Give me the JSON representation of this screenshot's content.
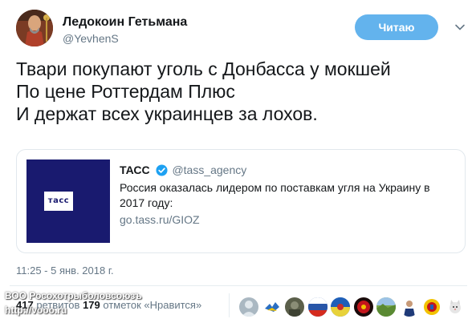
{
  "author": {
    "display_name": "Ледокоин Гетьмана",
    "handle": "@YevhenS",
    "avatar_icon": "avatar-portrait-icon"
  },
  "follow_button": {
    "label": "Читаю"
  },
  "tweet": {
    "lines": [
      "Твари покупают уголь с Донбасса у мокшей",
      "По цене Роттердам Плюс",
      "И держат всех украинцев за лохов."
    ]
  },
  "card": {
    "logo_text": "тасс",
    "name": "ТАСС",
    "handle": "@tass_agency",
    "description": "Россия оказалась лидером по поставкам угля на Украину в 2017 году:",
    "url": "go.tass.ru/GIOZ"
  },
  "timestamp": "11:25 - 5 янв. 2018 г.",
  "stats": {
    "retweets": "417",
    "likes_label": "179",
    "likes_text": "отметок «Нравится»",
    "mid_text": "ретвитов"
  },
  "watermark": {
    "line1": "ВОО Росохотрыболовсоюзъ",
    "line2": "http://vooo.ru"
  },
  "colors": {
    "accent": "#63b3ed",
    "text": "#14171a",
    "muted": "#657786",
    "border": "#e1e8ed",
    "tass_blue": "#191a6f"
  },
  "liker_avatars": [
    "gray-avatar-icon",
    "bird-avatar-icon",
    "soldier-avatar-icon",
    "flag-avatar-icon",
    "flag-avatar-icon",
    "red-avatar-icon",
    "landscape-avatar-icon",
    "person-avatar-icon",
    "emblem-avatar-icon",
    "cat-avatar-icon"
  ]
}
